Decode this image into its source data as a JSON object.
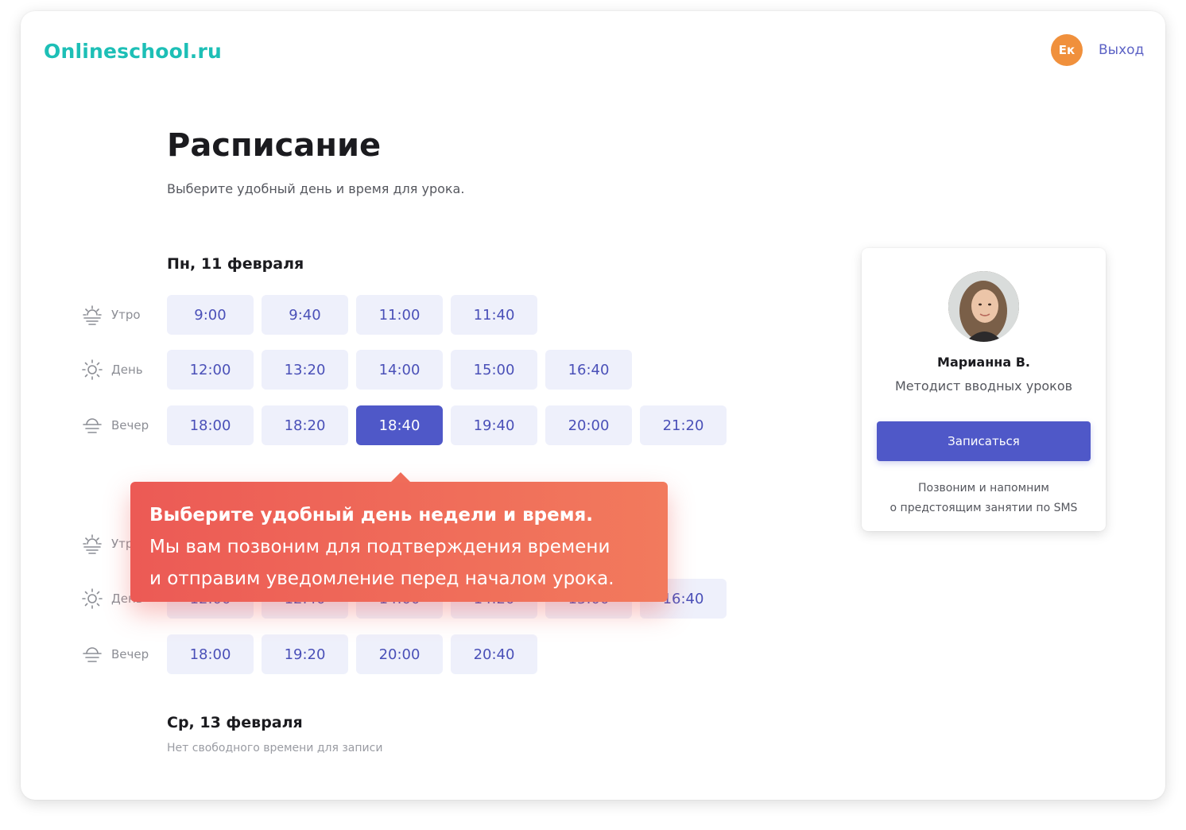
{
  "header": {
    "logo": "Onlineschool.ru",
    "user_initials": "Ек",
    "logout_label": "Выход"
  },
  "page": {
    "title": "Расписание",
    "subtitle": "Выберите удобный день и время для урока."
  },
  "periods": {
    "morning": "Утро",
    "day": "День",
    "evening": "Вечер"
  },
  "days": [
    {
      "title": "Пн, 11 февраля",
      "morning": [
        "9:00",
        "9:40",
        "11:00",
        "11:40"
      ],
      "day": [
        "12:00",
        "13:20",
        "14:00",
        "15:00",
        "16:40"
      ],
      "evening": [
        "18:00",
        "18:20",
        "18:40",
        "19:40",
        "20:00",
        "21:20"
      ],
      "selected": "18:40"
    },
    {
      "title": "",
      "morning": [],
      "day": [
        "12:00",
        "12:40",
        "14:00",
        "14:20",
        "15:00",
        "16:40"
      ],
      "evening": [
        "18:00",
        "19:20",
        "20:00",
        "20:40"
      ]
    },
    {
      "title": "Ср, 13 февраля",
      "empty_note": "Нет свободного времени для записи"
    }
  ],
  "tooltip": {
    "line1": "Выберите удобный день недели и время.",
    "line2": "Мы вам позвоним для подтверждения времени",
    "line3": "и отправим уведомление перед началом урока."
  },
  "teacher": {
    "name": "Марианна В.",
    "role": "Методист вводных уроков",
    "button_label": "Записаться",
    "note_line1": "Позвоним и напомним",
    "note_line2": "о предстоящим занятии по SMS"
  },
  "colors": {
    "brand": "#1dbfb6",
    "accent": "#4f58c8",
    "slot_bg": "#eef0fb",
    "avatar": "#f0903c",
    "tooltip": "#ec5a55"
  }
}
